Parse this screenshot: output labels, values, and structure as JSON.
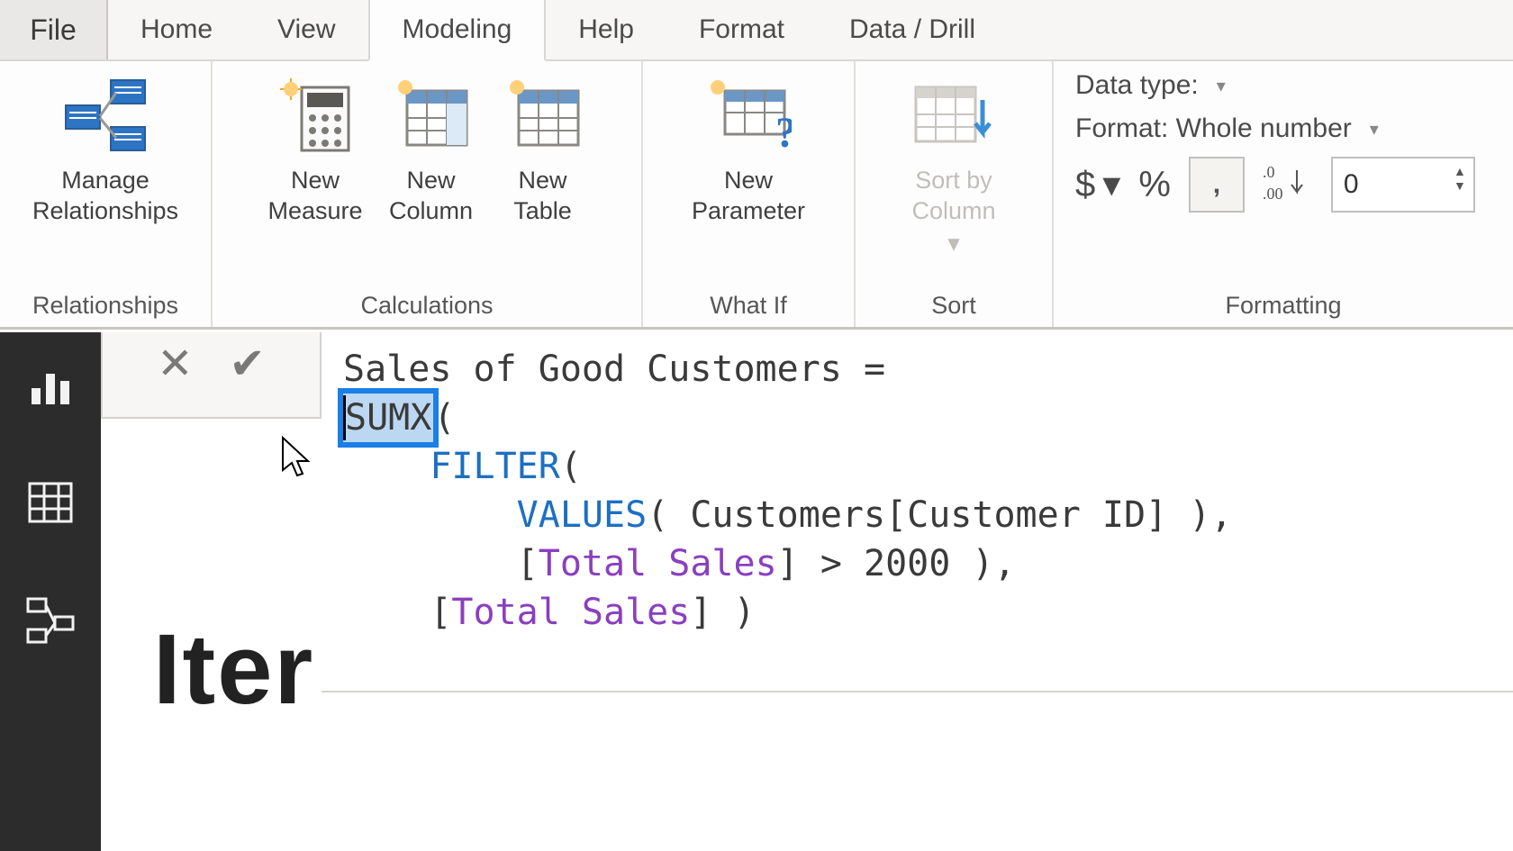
{
  "tabs": {
    "file": "File",
    "home": "Home",
    "view": "View",
    "modeling": "Modeling",
    "help": "Help",
    "format": "Format",
    "data_drill": "Data / Drill"
  },
  "ribbon": {
    "relationships": {
      "manage": "Manage\nRelationships",
      "label": "Relationships"
    },
    "calculations": {
      "new_measure": "New\nMeasure",
      "new_column": "New\nColumn",
      "new_table": "New\nTable",
      "label": "Calculations"
    },
    "whatif": {
      "new_parameter": "New\nParameter",
      "label": "What If"
    },
    "sort": {
      "sort_by_column": "Sort by\nColumn",
      "label": "Sort"
    },
    "formatting": {
      "data_type_label": "Data type:",
      "format_label": "Format: Whole number",
      "dollar": "$",
      "percent": "%",
      "thousands": ",",
      "decimals_icon": ".0 .00",
      "decimals_value": "0",
      "label": "Formatting"
    }
  },
  "formula": {
    "line1": "Sales of Good Customers = ",
    "sumx": "SUMX",
    "after_sumx": "(",
    "filter": "FILTER",
    "values": "VALUES",
    "values_arg": "( Customers[Customer ID] ),",
    "total_sales": "Total Sales",
    "filter_cond_tail": " > 2000 ),",
    "close": " )"
  },
  "canvas": {
    "heading": "Iter"
  }
}
